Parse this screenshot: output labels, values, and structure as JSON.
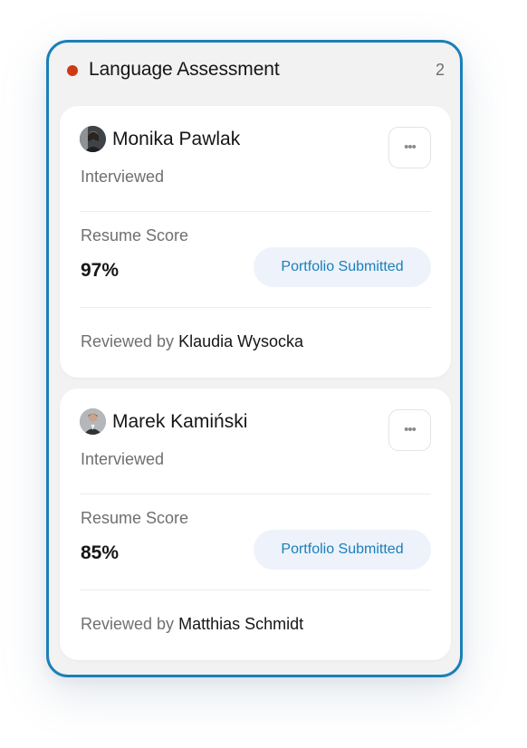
{
  "column": {
    "title": "Language Assessment",
    "count": "2",
    "status_color": "#cf3a12",
    "accent_color": "#1b7fb8"
  },
  "cards": [
    {
      "name": "Monika Pawlak",
      "stage": "Interviewed",
      "score_label": "Resume Score",
      "score": "97%",
      "tag": "Portfolio Submitted",
      "reviewed_prefix": "Reviewed by",
      "reviewer": "Klaudia Wysocka",
      "menu_icon": "more-horizontal-icon"
    },
    {
      "name": "Marek Kamiński",
      "stage": "Interviewed",
      "score_label": "Resume Score",
      "score": "85%",
      "tag": "Portfolio Submitted",
      "reviewed_prefix": "Reviewed by",
      "reviewer": "Matthias Schmidt",
      "menu_icon": "more-horizontal-icon"
    }
  ]
}
